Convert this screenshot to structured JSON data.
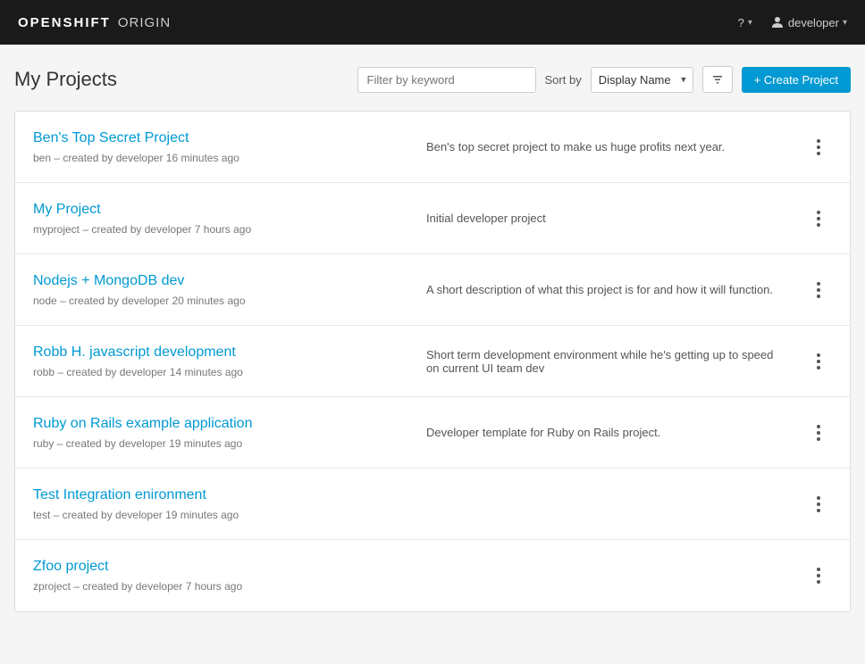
{
  "header": {
    "logo_openshift": "OPENSHIFT",
    "logo_origin": "ORIGIN",
    "help_label": "?",
    "help_chevron": "▾",
    "user_label": "developer",
    "user_chevron": "▾"
  },
  "main": {
    "page_title": "My Projects",
    "filter_placeholder": "Filter by keyword",
    "sort_label": "Sort by",
    "sort_selected": "Display Name",
    "sort_order_icon": "sort-icon",
    "create_button_label": "+ Create Project"
  },
  "projects": [
    {
      "name": "Ben's Top Secret Project",
      "meta": "ben – created by developer 16 minutes ago",
      "description": "Ben's top secret project to make us huge profits next year.",
      "actions_label": "⋮"
    },
    {
      "name": "My Project",
      "meta": "myproject – created by developer 7 hours ago",
      "description": "Initial developer project",
      "actions_label": "⋮"
    },
    {
      "name": "Nodejs + MongoDB dev",
      "meta": "node – created by developer 20 minutes ago",
      "description": "A short description of what this project is for and how it will function.",
      "actions_label": "⋮"
    },
    {
      "name": "Robb H. javascript development",
      "meta": "robb – created by developer 14 minutes ago",
      "description": "Short term development environment while he's getting up to speed on current UI team dev",
      "actions_label": "⋮"
    },
    {
      "name": "Ruby on Rails example application",
      "meta": "ruby – created by developer 19 minutes ago",
      "description": "Developer template for Ruby on Rails project.",
      "actions_label": "⋮"
    },
    {
      "name": "Test Integration enironment",
      "meta": "test – created by developer 19 minutes ago",
      "description": "",
      "actions_label": "⋮"
    },
    {
      "name": "Zfoo project",
      "meta": "zproject – created by developer 7 hours ago",
      "description": "",
      "actions_label": "⋮"
    }
  ]
}
